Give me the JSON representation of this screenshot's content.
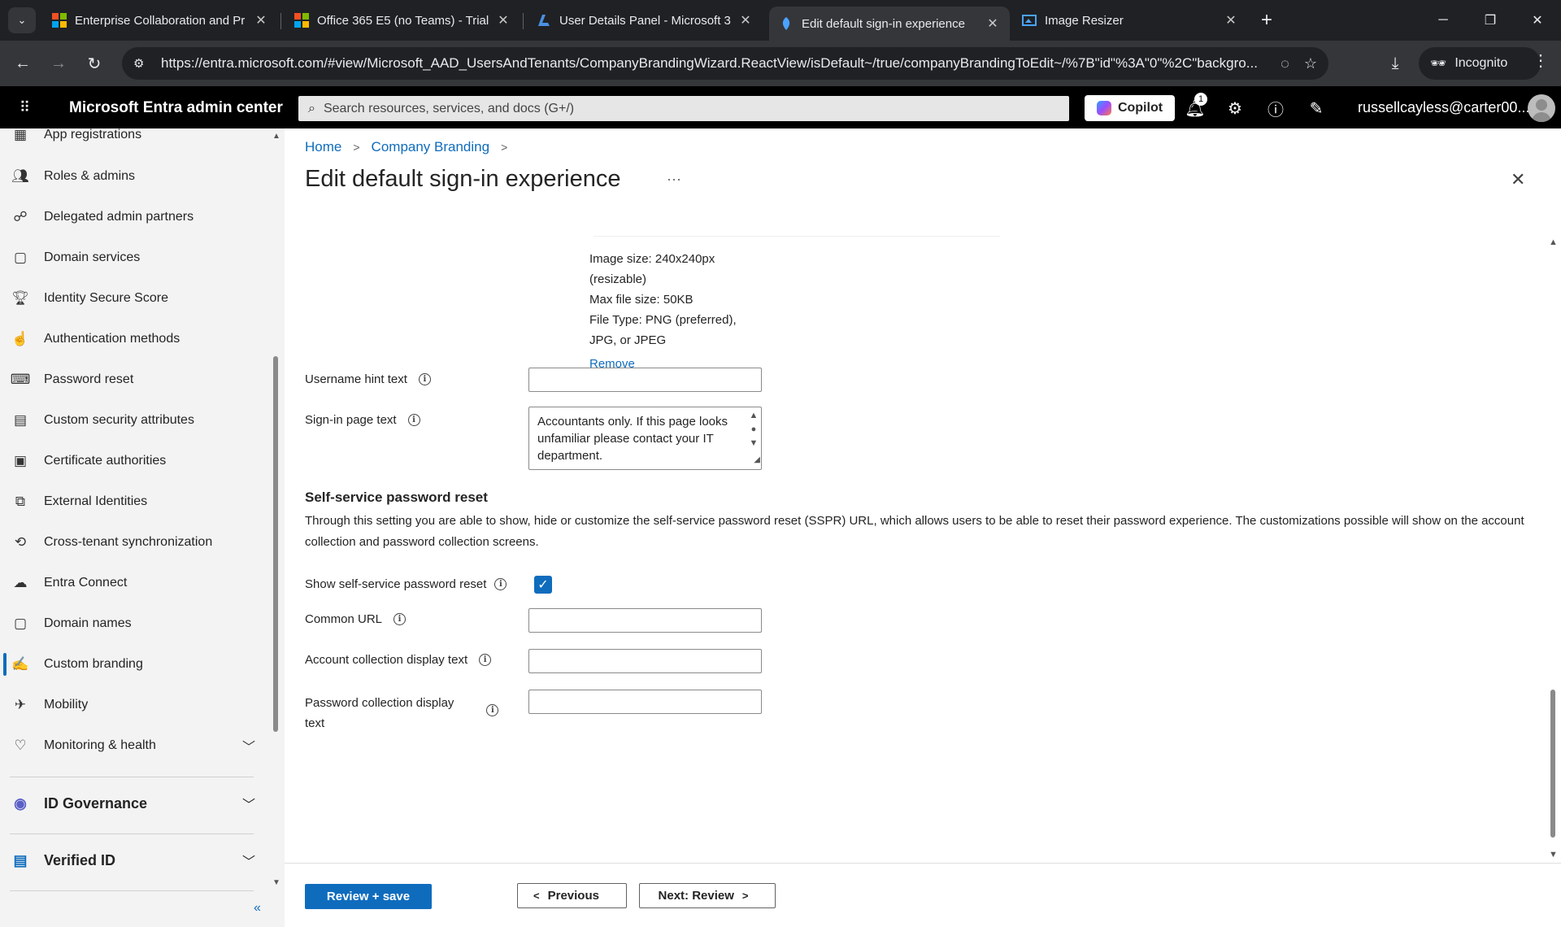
{
  "browser": {
    "tabs": [
      {
        "title": "Enterprise Collaboration and Pr",
        "active": false
      },
      {
        "title": "Office 365 E5 (no Teams) - Trial",
        "active": false
      },
      {
        "title": "User Details Panel - Microsoft 3",
        "active": false
      },
      {
        "title": "Edit default sign-in experience",
        "active": true
      },
      {
        "title": "Image Resizer",
        "active": false
      }
    ],
    "url": "https://entra.microsoft.com/#view/Microsoft_AAD_UsersAndTenants/CompanyBrandingWizard.ReactView/isDefault~/true/companyBrandingToEdit~/%7B\"id\"%3A\"0\"%2C\"backgro...",
    "incognito_label": "Incognito"
  },
  "header": {
    "app_title": "Microsoft Entra admin center",
    "search_placeholder": "Search resources, services, and docs (G+/)",
    "copilot_label": "Copilot",
    "notification_count": "1",
    "account": "russellcayless@carter00..."
  },
  "sidebar": {
    "items": [
      {
        "label": "App registrations",
        "icon": "app-grid-icon"
      },
      {
        "label": "Roles & admins",
        "icon": "roles-icon"
      },
      {
        "label": "Delegated admin partners",
        "icon": "partners-icon"
      },
      {
        "label": "Domain services",
        "icon": "domain-services-icon"
      },
      {
        "label": "Identity Secure Score",
        "icon": "trophy-icon"
      },
      {
        "label": "Authentication methods",
        "icon": "auth-methods-icon"
      },
      {
        "label": "Password reset",
        "icon": "password-icon"
      },
      {
        "label": "Custom security attributes",
        "icon": "attributes-icon"
      },
      {
        "label": "Certificate authorities",
        "icon": "certificate-icon"
      },
      {
        "label": "External Identities",
        "icon": "external-icon"
      },
      {
        "label": "Cross-tenant synchronization",
        "icon": "sync-icon"
      },
      {
        "label": "Entra Connect",
        "icon": "connect-icon"
      },
      {
        "label": "Domain names",
        "icon": "domain-names-icon"
      },
      {
        "label": "Custom branding",
        "icon": "branding-icon",
        "active": true
      },
      {
        "label": "Mobility",
        "icon": "mobility-icon"
      },
      {
        "label": "Monitoring & health",
        "icon": "heart-icon",
        "expandable": true
      }
    ],
    "sections": [
      {
        "label": "ID Governance",
        "icon": "governance-icon"
      },
      {
        "label": "Verified ID",
        "icon": "verified-id-icon"
      }
    ]
  },
  "page": {
    "breadcrumb": [
      "Home",
      "Company Branding"
    ],
    "title": "Edit default sign-in experience",
    "image_info": [
      "Image size: 240x240px",
      "(resizable)",
      "Max file size: 50KB",
      "File Type: PNG (preferred),",
      "JPG, or JPEG"
    ],
    "remove_label": "Remove",
    "username_hint_label": "Username hint text",
    "username_hint_value": "",
    "signin_text_label": "Sign-in page text",
    "signin_text_value": "Accountants only. If this page looks unfamiliar please contact your IT department.",
    "sspr": {
      "heading": "Self-service password reset",
      "description": "Through this setting you are able to show, hide or customize the self-service password reset (SSPR) URL, which allows users to be able to reset their password experience. The customizations possible will show on the account collection and password collection screens.",
      "show_label": "Show self-service password reset",
      "show_checked": true,
      "common_url_label": "Common URL",
      "common_url_value": "",
      "account_collection_label": "Account collection display text",
      "account_collection_value": "",
      "password_collection_label_line1": "Password collection display",
      "password_collection_label_line2": "text",
      "password_collection_value": ""
    },
    "footer": {
      "review_save": "Review + save",
      "previous": "Previous",
      "next": "Next: Review"
    }
  },
  "colors": {
    "accent": "#0f6cbd",
    "header_bg": "#000000",
    "nav_bg": "#f3f3f3"
  }
}
